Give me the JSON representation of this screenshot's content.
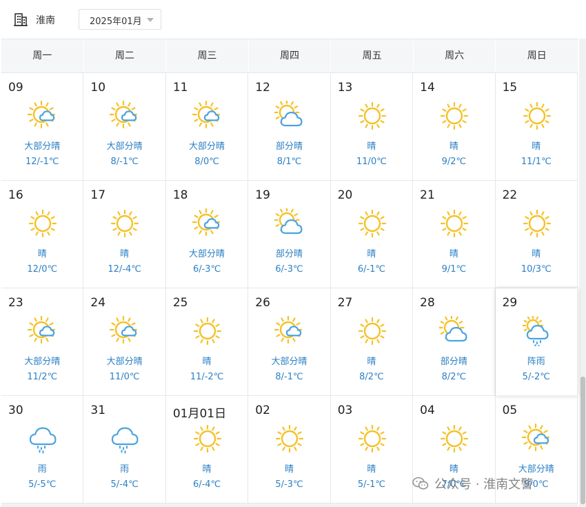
{
  "header": {
    "city": "淮南",
    "month": "2025年01月",
    "city_icon": "building-icon",
    "dropdown_icon": "caret-down-icon"
  },
  "weekdays": [
    "周一",
    "周二",
    "周三",
    "周四",
    "周五",
    "周六",
    "周日"
  ],
  "colors": {
    "accent": "#2a7fc4",
    "sun": "#f5c125",
    "cloud": "#4aa3df"
  },
  "days": [
    {
      "date": "09",
      "icon": "mostly-sunny-icon",
      "condition": "大部分晴",
      "temp": "12/-1℃"
    },
    {
      "date": "10",
      "icon": "mostly-sunny-icon",
      "condition": "大部分晴",
      "temp": "8/-1℃"
    },
    {
      "date": "11",
      "icon": "mostly-sunny-icon",
      "condition": "大部分晴",
      "temp": "8/0℃"
    },
    {
      "date": "12",
      "icon": "partly-sunny-icon",
      "condition": "部分晴",
      "temp": "8/1℃"
    },
    {
      "date": "13",
      "icon": "sunny-icon",
      "condition": "晴",
      "temp": "11/0℃"
    },
    {
      "date": "14",
      "icon": "sunny-icon",
      "condition": "晴",
      "temp": "9/2℃"
    },
    {
      "date": "15",
      "icon": "sunny-icon",
      "condition": "晴",
      "temp": "11/1℃"
    },
    {
      "date": "16",
      "icon": "sunny-icon",
      "condition": "晴",
      "temp": "12/0℃"
    },
    {
      "date": "17",
      "icon": "sunny-icon",
      "condition": "晴",
      "temp": "12/-4℃"
    },
    {
      "date": "18",
      "icon": "mostly-sunny-icon",
      "condition": "大部分晴",
      "temp": "6/-3℃"
    },
    {
      "date": "19",
      "icon": "partly-sunny-icon",
      "condition": "部分晴",
      "temp": "6/-3℃"
    },
    {
      "date": "20",
      "icon": "sunny-icon",
      "condition": "晴",
      "temp": "6/-1℃"
    },
    {
      "date": "21",
      "icon": "sunny-icon",
      "condition": "晴",
      "temp": "9/1℃"
    },
    {
      "date": "22",
      "icon": "sunny-icon",
      "condition": "晴",
      "temp": "10/3℃"
    },
    {
      "date": "23",
      "icon": "mostly-sunny-icon",
      "condition": "大部分晴",
      "temp": "11/2℃"
    },
    {
      "date": "24",
      "icon": "mostly-sunny-icon",
      "condition": "大部分晴",
      "temp": "11/0℃"
    },
    {
      "date": "25",
      "icon": "sunny-icon",
      "condition": "晴",
      "temp": "11/-2℃"
    },
    {
      "date": "26",
      "icon": "mostly-sunny-icon",
      "condition": "大部分晴",
      "temp": "8/-1℃"
    },
    {
      "date": "27",
      "icon": "sunny-icon",
      "condition": "晴",
      "temp": "8/2℃"
    },
    {
      "date": "28",
      "icon": "partly-sunny-icon",
      "condition": "部分晴",
      "temp": "8/2℃"
    },
    {
      "date": "29",
      "icon": "shower-icon",
      "condition": "阵雨",
      "temp": "5/-2℃",
      "active": true
    },
    {
      "date": "30",
      "icon": "rain-icon",
      "condition": "雨",
      "temp": "5/-5℃"
    },
    {
      "date": "31",
      "icon": "rain-icon",
      "condition": "雨",
      "temp": "5/-4℃"
    },
    {
      "date": "01月01日",
      "icon": "sunny-icon",
      "condition": "晴",
      "temp": "6/-4℃"
    },
    {
      "date": "02",
      "icon": "sunny-icon",
      "condition": "晴",
      "temp": "5/-3℃"
    },
    {
      "date": "03",
      "icon": "sunny-icon",
      "condition": "晴",
      "temp": "5/-1℃"
    },
    {
      "date": "04",
      "icon": "sunny-icon",
      "condition": "晴",
      "temp": "7/0℃"
    },
    {
      "date": "05",
      "icon": "mostly-sunny-icon",
      "condition": "大部分晴",
      "temp": "9/0℃"
    }
  ],
  "watermark": {
    "text": "公众号 · 淮南文警",
    "icon": "wechat-icon"
  }
}
